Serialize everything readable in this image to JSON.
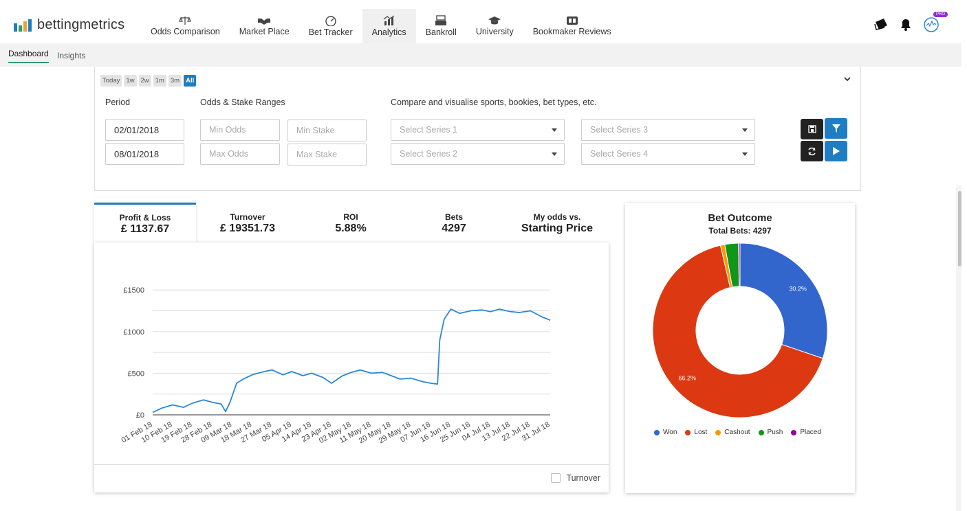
{
  "app": {
    "logo_text": "bettingmetrics",
    "nav": [
      {
        "label": "Odds Comparison",
        "icon": "scales-icon"
      },
      {
        "label": "Market Place",
        "icon": "handshake-icon"
      },
      {
        "label": "Bet Tracker",
        "icon": "gauge-icon"
      },
      {
        "label": "Analytics",
        "icon": "analytics-icon"
      },
      {
        "label": "Bankroll",
        "icon": "cash-register-icon"
      },
      {
        "label": "University",
        "icon": "graduation-cap-icon"
      },
      {
        "label": "Bookmaker Reviews",
        "icon": "bookmaker-icon"
      }
    ],
    "active_nav": "Analytics",
    "pro_badge": "PRO"
  },
  "subnav": {
    "items": [
      "Dashboard",
      "Insights"
    ],
    "active": "Dashboard"
  },
  "filters": {
    "ranges": [
      "Today",
      "1w",
      "2w",
      "1m",
      "3m",
      "All"
    ],
    "active_range": "All",
    "period_label": "Period",
    "ranges_label": "Odds & Stake Ranges",
    "compare_label": "Compare and visualise sports, bookies, bet types, etc.",
    "date_from": "02/01/2018",
    "date_to": "08/01/2018",
    "min_odds_placeholder": "Min Odds",
    "max_odds_placeholder": "Max Odds",
    "min_stake_placeholder": "Min Stake",
    "max_stake_placeholder": "Max Stake",
    "series": [
      "Select Series 1",
      "Select Series 2",
      "Select Series 3",
      "Select Series 4"
    ]
  },
  "stats": [
    {
      "label": "Profit & Loss",
      "value": "£ 1137.67"
    },
    {
      "label": "Turnover",
      "value": "£ 19351.73"
    },
    {
      "label": "ROI",
      "value": "5.88%"
    },
    {
      "label": "Bets",
      "value": "4297"
    },
    {
      "label": "My odds vs.",
      "value": "Starting Price"
    }
  ],
  "turnover_toggle": "Turnover",
  "colors": {
    "accent": "#1f7ec3",
    "line": "#2a87d8",
    "won": "#3366cc",
    "lost": "#dc3912",
    "cashout": "#ff9900",
    "push": "#109618",
    "placed": "#990099"
  },
  "chart_data": [
    {
      "type": "line",
      "title": "",
      "xlabel": "",
      "ylabel": "",
      "ylim": [
        0,
        1700
      ],
      "y_ticks": [
        "£0",
        "£500",
        "£1000",
        "£1500"
      ],
      "x_ticks": [
        "01 Feb 18",
        "10 Feb 18",
        "19 Feb 18",
        "28 Feb 18",
        "09 Mar 18",
        "18 Mar 18",
        "27 Mar 18",
        "05 Apr 18",
        "14 Apr 18",
        "23 Apr 18",
        "02 May 18",
        "11 May 18",
        "20 May 18",
        "29 May 18",
        "07 Jun 18",
        "16 Jun 18",
        "25 Jun 18",
        "04 Jul 18",
        "13 Jul 18",
        "22 Jul 18",
        "31 Jul 18"
      ],
      "x": [
        "2018-02-01",
        "2018-02-05",
        "2018-02-10",
        "2018-02-15",
        "2018-02-19",
        "2018-02-24",
        "2018-02-28",
        "2018-03-04",
        "2018-03-06",
        "2018-03-08",
        "2018-03-11",
        "2018-03-14",
        "2018-03-18",
        "2018-03-22",
        "2018-03-27",
        "2018-04-01",
        "2018-04-05",
        "2018-04-10",
        "2018-04-14",
        "2018-04-19",
        "2018-04-23",
        "2018-04-28",
        "2018-05-02",
        "2018-05-06",
        "2018-05-11",
        "2018-05-16",
        "2018-05-20",
        "2018-05-24",
        "2018-05-29",
        "2018-06-03",
        "2018-06-07",
        "2018-06-10",
        "2018-06-11",
        "2018-06-13",
        "2018-06-16",
        "2018-06-20",
        "2018-06-25",
        "2018-06-30",
        "2018-07-04",
        "2018-07-08",
        "2018-07-13",
        "2018-07-17",
        "2018-07-22",
        "2018-07-27",
        "2018-07-31"
      ],
      "series": [
        {
          "values": [
            30,
            80,
            120,
            90,
            140,
            180,
            150,
            130,
            40,
            150,
            380,
            430,
            480,
            510,
            540,
            480,
            520,
            470,
            500,
            450,
            380,
            470,
            510,
            540,
            500,
            510,
            470,
            430,
            440,
            400,
            380,
            370,
            900,
            1150,
            1270,
            1220,
            1250,
            1260,
            1240,
            1270,
            1240,
            1230,
            1250,
            1180,
            1137
          ]
        }
      ]
    },
    {
      "type": "pie",
      "title": "Bet Outcome",
      "subtitle": "Total Bets: 4297",
      "categories": [
        "Won",
        "Lost",
        "Cashout",
        "Push",
        "Placed"
      ],
      "values": [
        30.2,
        66.2,
        0.8,
        2.5,
        0.3
      ],
      "labels": [
        "30.2%",
        "66.2%"
      ],
      "legend": "bottom"
    }
  ]
}
